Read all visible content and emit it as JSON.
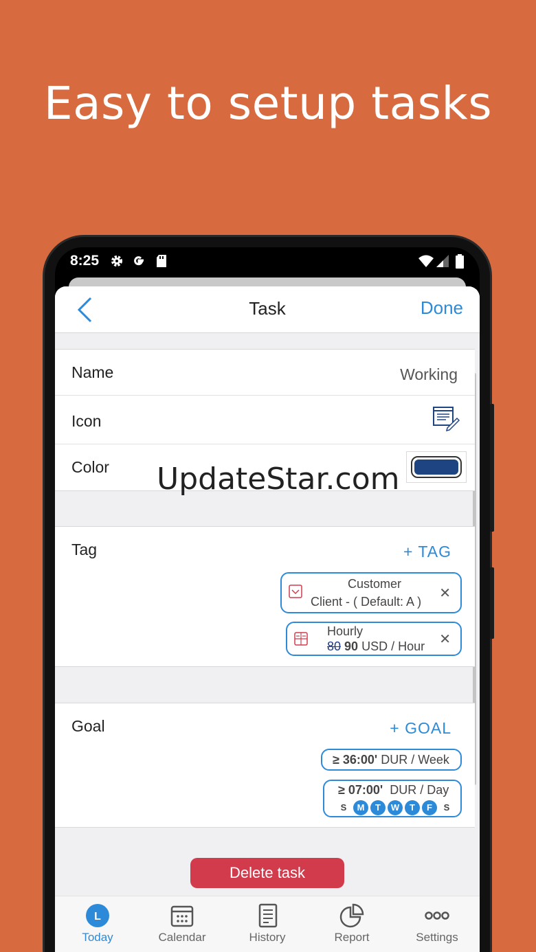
{
  "headline": "Easy to setup tasks",
  "status": {
    "time": "8:25",
    "icons": [
      "gear-icon",
      "google-icon",
      "sd-card-icon",
      "wifi-icon",
      "signal-icon",
      "battery-icon"
    ]
  },
  "nav": {
    "title": "Task",
    "done_label": "Done"
  },
  "fields": {
    "name_label": "Name",
    "name_value": "Working",
    "icon_label": "Icon",
    "color_label": "Color",
    "color_value": "#1e4582"
  },
  "tag": {
    "label": "Tag",
    "add_label": "+ TAG",
    "chips": [
      {
        "title": "Customer",
        "detail": "Client - ( Default: A )"
      },
      {
        "title": "Hourly",
        "old_rate": "80",
        "new_rate": "90",
        "unit": "USD / Hour"
      }
    ]
  },
  "goal": {
    "label": "Goal",
    "add_label": "+ GOAL",
    "weekly": {
      "amount": "≥ 36:00'",
      "unit": "DUR / Week"
    },
    "daily": {
      "amount": "≥ 07:00'",
      "unit": "DUR / Day"
    },
    "days": [
      {
        "letter": "S",
        "on": false
      },
      {
        "letter": "M",
        "on": true
      },
      {
        "letter": "T",
        "on": true
      },
      {
        "letter": "W",
        "on": true
      },
      {
        "letter": "T",
        "on": true
      },
      {
        "letter": "F",
        "on": true
      },
      {
        "letter": "S",
        "on": false
      }
    ]
  },
  "delete_label": "Delete task",
  "watermark": "UpdateStar.com",
  "tabs": [
    {
      "label": "Today",
      "icon": "clock-icon",
      "badge": "L"
    },
    {
      "label": "Calendar",
      "icon": "calendar-icon"
    },
    {
      "label": "History",
      "icon": "history-icon"
    },
    {
      "label": "Report",
      "icon": "pie-chart-icon"
    },
    {
      "label": "Settings",
      "icon": "more-icon"
    }
  ],
  "colors": {
    "background": "#d76a3e",
    "accent": "#2d8ad8",
    "danger": "#d13b4c"
  }
}
